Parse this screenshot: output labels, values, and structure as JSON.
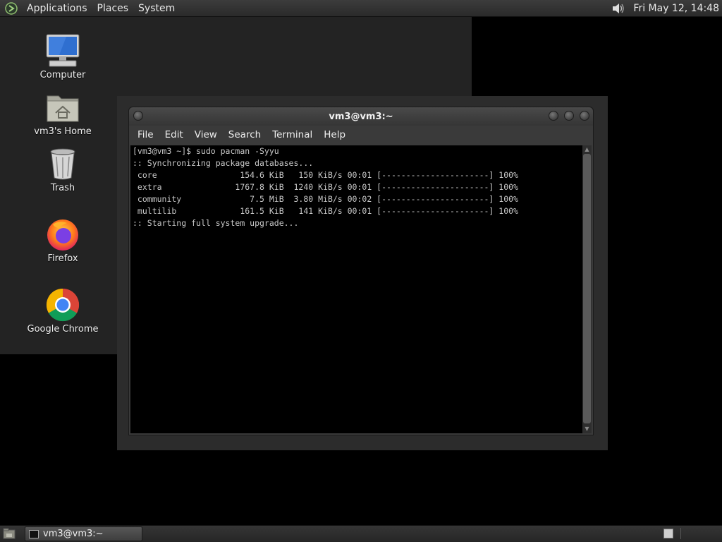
{
  "top_panel": {
    "menus": [
      "Applications",
      "Places",
      "System"
    ],
    "clock": "Fri May 12, 14:48"
  },
  "desktop": {
    "icons": [
      {
        "label": "Computer",
        "icon": "computer-icon"
      },
      {
        "label": "vm3's Home",
        "icon": "home-folder-icon"
      },
      {
        "label": "Trash",
        "icon": "trash-icon"
      },
      {
        "label": "Firefox",
        "icon": "firefox-icon"
      },
      {
        "label": "Google Chrome",
        "icon": "chrome-icon"
      }
    ]
  },
  "terminal": {
    "title": "vm3@vm3:~",
    "menus": [
      "File",
      "Edit",
      "View",
      "Search",
      "Terminal",
      "Help"
    ],
    "lines": [
      "[vm3@vm3 ~]$ sudo pacman -Syyu",
      ":: Synchronizing package databases...",
      " core                 154.6 KiB   150 KiB/s 00:01 [----------------------] 100%",
      " extra               1767.8 KiB  1240 KiB/s 00:01 [----------------------] 100%",
      " community              7.5 MiB  3.80 MiB/s 00:02 [----------------------] 100%",
      " multilib             161.5 KiB   141 KiB/s 00:01 [----------------------] 100%",
      ":: Starting full system upgrade..."
    ]
  },
  "taskbar": {
    "task_label": "vm3@vm3:~"
  }
}
